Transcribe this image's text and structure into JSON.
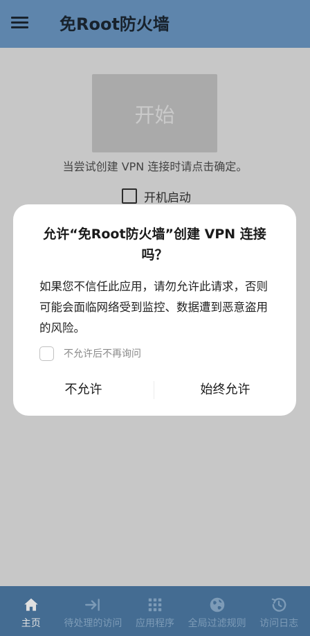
{
  "app": {
    "title": "免Root防火墙",
    "menu_icon": "hamburger-menu-icon"
  },
  "main": {
    "start_button": "开始",
    "hint": "当尝试创建 VPN 连接时请点击确定。",
    "boot_start": {
      "label": "开机启动",
      "checked": false
    }
  },
  "dialog": {
    "title": "允许“免Root防火墙”创建 VPN 连接吗？",
    "message": "如果您不信任此应用，请勿允许此请求，否则可能会面临网络受到监控、数据遭到恶意盗用的风险。",
    "dont_ask": {
      "label": "不允许后不再询问",
      "checked": false
    },
    "deny_button": "不允许",
    "allow_button": "始终允许"
  },
  "bottom_nav": {
    "items": [
      {
        "label": "主页",
        "icon": "home-icon",
        "active": true
      },
      {
        "label": "待处理的访问",
        "icon": "arrow-to-bar-icon",
        "active": false
      },
      {
        "label": "应用程序",
        "icon": "apps-grid-icon",
        "active": false
      },
      {
        "label": "全局过滤规则",
        "icon": "globe-icon",
        "active": false
      },
      {
        "label": "访问日志",
        "icon": "history-icon",
        "active": false
      }
    ]
  },
  "colors": {
    "appbar": "#6b98c4",
    "bottom_nav": "#4e7ca7",
    "nav_active": "#ffffff",
    "nav_inactive": "#8fb1d1",
    "start_button": "#c2c2c2"
  }
}
